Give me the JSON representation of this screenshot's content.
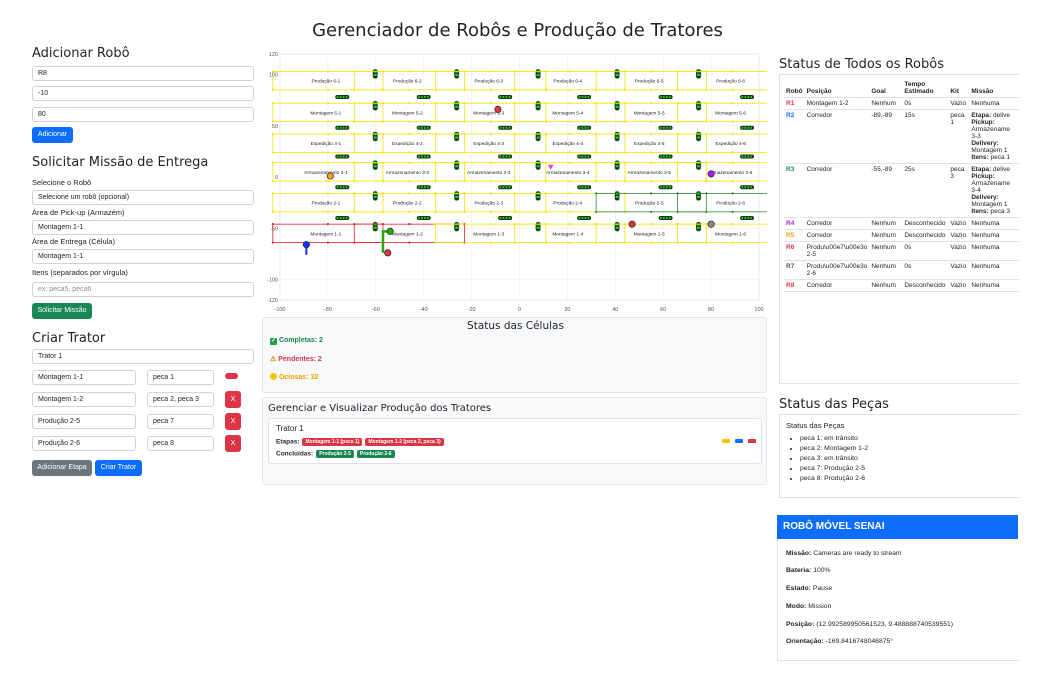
{
  "page_title": "Gerenciador de Robôs e Produção de Tratores",
  "add_robot": {
    "title": "Adicionar Robô",
    "fields": [
      "R8",
      "-10",
      "80"
    ],
    "button": "Adicionar"
  },
  "mission": {
    "title": "Solicitar Missão de Entrega",
    "robot_label": "Selecione o Robô",
    "robot_value": "Selecione um robô (opcional)",
    "pickup_label": "Área de Pick-up (Armazém)",
    "pickup_value": "Montagem 1-1",
    "delivery_label": "Área de Entrega (Célula)",
    "delivery_value": "Montagem 1-1",
    "items_label": "Itens (separados por vírgula)",
    "items_placeholder": "ex: peca5, peca6",
    "button": "Solicitar Missão"
  },
  "tractor": {
    "title": "Criar Trator",
    "name_value": "Trator 1",
    "stages": [
      {
        "cell": "Montagem 1-1",
        "parts": "peca 1",
        "remove": ""
      },
      {
        "cell": "Montagem 1-2",
        "parts": "peca 2, peca 3",
        "remove": "X"
      },
      {
        "cell": "Produção 2-5",
        "parts": "peca 7",
        "remove": "X"
      },
      {
        "cell": "Produção 2-6",
        "parts": "peca 8",
        "remove": "X"
      }
    ],
    "add_stage_button": "Adicionar Etapa",
    "create_button": "Criar Trator"
  },
  "map": {
    "x_ticks": [
      "-100",
      "-80",
      "-60",
      "-40",
      "-20",
      "0",
      "20",
      "40",
      "60",
      "80",
      "100"
    ],
    "y_ticks": [
      "100",
      "80",
      "60",
      "40",
      "20",
      "0",
      "-20",
      "-40",
      "-60",
      "-80",
      "-100",
      "-120"
    ],
    "y_ticks_visible": [
      "120",
      "100",
      "",
      "50",
      "",
      "0",
      "",
      "-50",
      "",
      "-100",
      "",
      "-120"
    ],
    "rows": [
      [
        "Produção 6-1",
        "Produção 6-2",
        "Produção 6-3",
        "Produção 6-4",
        "Produção 6-5",
        "Produção 6-6"
      ],
      [
        "Montagem 5-1",
        "Montagem 5-2",
        "Montagem 5-3",
        "Montagem 5-4",
        "Montagem 5-5",
        "Montagem 5-6"
      ],
      [
        "Expedição 4-1",
        "Expedição 4-2",
        "Expedição 4-3",
        "Expedição 4-4",
        "Expedição 4-5",
        "Expedição 4-6"
      ],
      [
        "Armazenamento 3-1",
        "Armazenamento 3-2",
        "Armazenamento 3-3",
        "Armazenamento 3-4",
        "Armazenamento 3-5",
        "Armazenamento 3-6"
      ],
      [
        "Produção 2-1",
        "Produção 2-2",
        "Produção 2-3",
        "Produção 2-4",
        "Produção 2-5",
        "Produção 2-6"
      ],
      [
        "Montagem 1-1",
        "Montagem 1-2",
        "Montagem 1-3",
        "Montagem 1-4",
        "Montagem 1-5",
        "Montagem 1-6"
      ]
    ],
    "colors": {
      "idle": "#f5e400",
      "pending": "#e0202a",
      "complete": "#2e8b3a"
    }
  },
  "cell_status": {
    "title": "Status das Células",
    "completas": "Completas: 2",
    "pendentes": "Pendentes: 2",
    "ociosas": "Ociosas: 32"
  },
  "production": {
    "title": "Gerenciar e Visualizar Produção dos Tratores",
    "tractor_name": "Trator 1",
    "etapas_label": "Etapas:",
    "etapas": [
      "Montagem 1-1 (peca 1)",
      "Montagem 1-2 (peca 2, peca 3)"
    ],
    "concluidas_label": "Concluídas:",
    "concluidas": [
      "Produção 2-5",
      "Produção 2-6"
    ]
  },
  "robots_status": {
    "title": "Status de Todos os Robôs",
    "headers": [
      "Robô",
      "Posição",
      "Goal",
      "Tempo Estimado",
      "Kit",
      "Missão"
    ],
    "rows": [
      {
        "id": "R1",
        "color": "#dc3545",
        "pos": "Montagem 1-2",
        "goal": "Nenhum",
        "time": "0s",
        "kit": "Vazio",
        "mission": "Nenhuma"
      },
      {
        "id": "R2",
        "color": "#0d6efd",
        "pos": "Corredor",
        "goal": "-89,-89",
        "time": "15s",
        "kit": "peca 1",
        "mission_lines": [
          [
            "Etapa:",
            " delive"
          ],
          [
            "Pickup:",
            ""
          ],
          [
            "",
            "Armazename"
          ],
          [
            "",
            "3-3"
          ],
          [
            "Delivery:",
            ""
          ],
          [
            "",
            "Montagem 1"
          ],
          [
            "Itens:",
            " peca 1"
          ]
        ]
      },
      {
        "id": "R3",
        "color": "#198754",
        "pos": "Corredor",
        "goal": "-55,-89",
        "time": "25s",
        "kit": "peca 3",
        "mission_lines": [
          [
            "Etapa:",
            " delive"
          ],
          [
            "Pickup:",
            ""
          ],
          [
            "",
            "Armazename"
          ],
          [
            "",
            "3-4"
          ],
          [
            "Delivery:",
            ""
          ],
          [
            "",
            "Montagem 1"
          ],
          [
            "Itens:",
            " peca 3"
          ]
        ]
      },
      {
        "id": "R4",
        "color": "#a020f0",
        "pos": "Corredor",
        "goal": "Nenhum",
        "time": "Desconhecido",
        "kit": "Vazio",
        "mission": "Nenhuma"
      },
      {
        "id": "R5",
        "color": "#fd9d0d",
        "pos": "Corredor",
        "goal": "Nenhum",
        "time": "Desconhecido",
        "kit": "Vazio",
        "mission": "Nenhuma"
      },
      {
        "id": "R6",
        "color": "#dc3545",
        "pos": "Produ\\u00e7\\u00e3o 2-5",
        "goal": "Nenhum",
        "time": "0s",
        "kit": "Vazio",
        "mission": "Nenhuma"
      },
      {
        "id": "R7",
        "color": "#555555",
        "pos": "Produ\\u00e7\\u00e3o 2-6",
        "goal": "Nenhum",
        "time": "0s",
        "kit": "Vazio",
        "mission": "Nenhuma"
      },
      {
        "id": "R8",
        "color": "#dc3545",
        "pos": "Corredor",
        "goal": "Nenhum",
        "time": "Desconhecido",
        "kit": "Vazio",
        "mission": "Nenhuma"
      }
    ]
  },
  "parts_status": {
    "title": "Status das Peças",
    "subtitle": "Status das Peças",
    "items": [
      "peca 1: em trânsito",
      "peca 2: Montagem 1-2",
      "peca 3: em trânsito",
      "peca 7: Produção 2-5",
      "peca 8: Produção 2-6"
    ]
  },
  "robo_senai": {
    "title": "ROBÔ MÓVEL SENAI",
    "rows": [
      {
        "label": "Missão:",
        "value": " Cameras are ready to stream"
      },
      {
        "label": "Bateria:",
        "value": " 100%"
      },
      {
        "label": "Estado:",
        "value": " Pause"
      },
      {
        "label": "Modo:",
        "value": " Mission"
      },
      {
        "label": "Posição:",
        "value": " (12.992589950561523, 9.488888740539551)"
      },
      {
        "label": "Orientação:",
        "value": " -169.8416748046875°"
      }
    ]
  }
}
